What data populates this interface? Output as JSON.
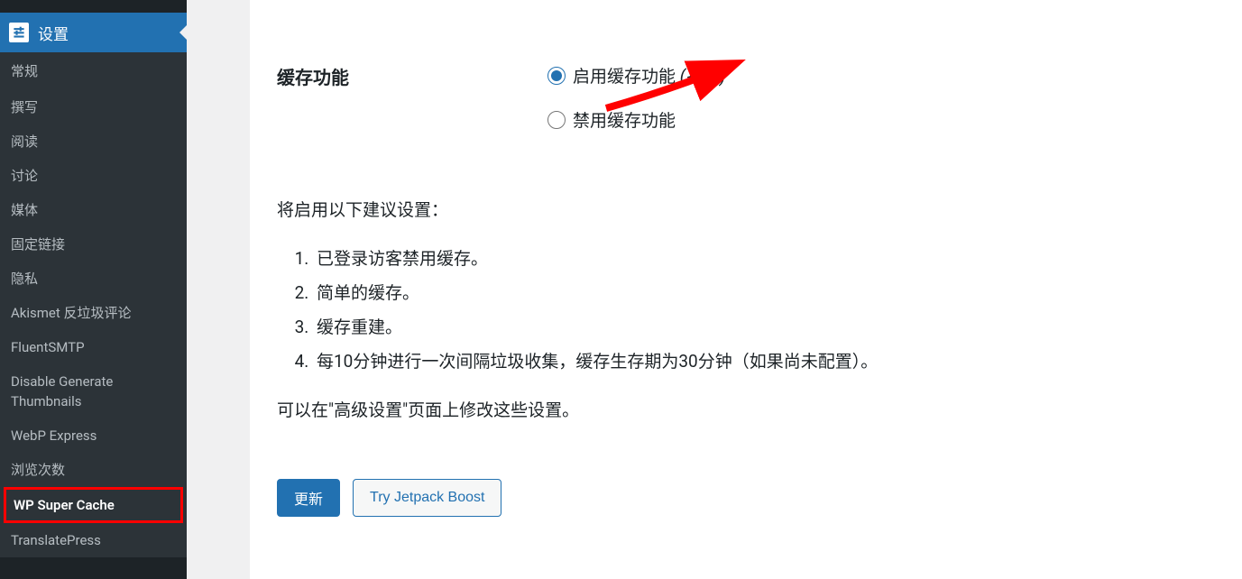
{
  "sidebar": {
    "current_label": "设置",
    "items": [
      "常规",
      "撰写",
      "阅读",
      "讨论",
      "媒体",
      "固定链接",
      "隐私",
      "Akismet 反垃圾评论",
      "FluentSMTP",
      "Disable Generate Thumbnails",
      "WebP Express",
      "浏览次数",
      "WP Super Cache",
      "TranslatePress"
    ],
    "active_index": 12
  },
  "form": {
    "section_label": "缓存功能",
    "radio_enable_label": "启用缓存功能",
    "radio_enable_recommend": "(推荐)",
    "radio_disable_label": "禁用缓存功能"
  },
  "desc": {
    "intro": "将启用以下建议设置：",
    "items": [
      "已登录访客禁用缓存。",
      "简单的缓存。",
      "缓存重建。",
      "每10分钟进行一次间隔垃圾收集，缓存生存期为30分钟（如果尚未配置）。"
    ],
    "footer": "可以在\"高级设置\"页面上修改这些设置。"
  },
  "buttons": {
    "update": "更新",
    "try_boost": "Try Jetpack Boost"
  }
}
